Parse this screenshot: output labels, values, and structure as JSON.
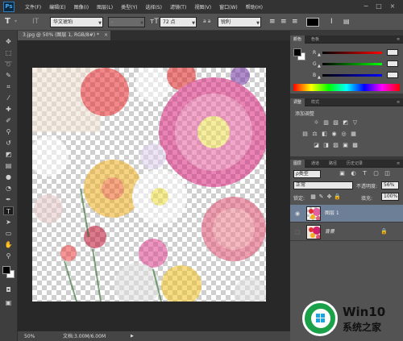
{
  "app": {
    "logo": "Ps"
  },
  "menu": [
    "文件(F)",
    "编辑(E)",
    "图像(I)",
    "图层(L)",
    "类型(Y)",
    "选择(S)",
    "滤镜(T)",
    "视图(V)",
    "窗口(W)",
    "帮助(H)"
  ],
  "window_controls": {
    "minimize": "−",
    "restore": "□",
    "close": "×"
  },
  "options": {
    "tool_icon": "type-tool-icon",
    "orientation_icon": "toggle-orientation-icon",
    "font_family": "华文琥珀",
    "font_style": "-",
    "font_size": "72 点",
    "aa_label": "a a",
    "aa_mode": "锐利",
    "color": "#000000"
  },
  "tools": [
    "move-tool-icon",
    "marquee-tool-icon",
    "lasso-tool-icon",
    "quick-select-icon",
    "crop-tool-icon",
    "eyedropper-icon",
    "healing-brush-icon",
    "brush-tool-icon",
    "clone-stamp-icon",
    "history-brush-icon",
    "eraser-tool-icon",
    "gradient-tool-icon",
    "blur-tool-icon",
    "dodge-tool-icon",
    "pen-tool-icon",
    "type-tool-icon",
    "path-select-icon",
    "shape-tool-icon",
    "hand-tool-icon",
    "zoom-tool-icon"
  ],
  "document": {
    "tab_title": "3.jpg @ 50% (图层 1, RGB/8#) *",
    "close": "×"
  },
  "status": {
    "zoom": "50%",
    "doc_info": "文档:3.00M/6.00M"
  },
  "color_panel": {
    "tabs": [
      "颜色",
      "色板"
    ],
    "channels": [
      {
        "label": "R",
        "color": "#ff0000"
      },
      {
        "label": "G",
        "color": "#00ff00"
      },
      {
        "label": "B",
        "color": "#0000ff"
      }
    ],
    "foreground": "#000000",
    "background": "#ffffff"
  },
  "adjust_panel": {
    "tabs": [
      "调整",
      "样式"
    ],
    "title": "添加调整"
  },
  "layers_panel": {
    "tabs": [
      "图层",
      "通道",
      "路径",
      "历史记录"
    ],
    "filter_kind": "ρ类型",
    "blend_mode": "正常",
    "opacity_label": "不透明度:",
    "opacity": "56%",
    "lock_label": "锁定:",
    "fill_label": "填充:",
    "fill": "100%",
    "layers": [
      {
        "name": "图层 1",
        "selected": true
      },
      {
        "name": "背景",
        "selected": false
      }
    ]
  },
  "watermark": {
    "title": "Win10",
    "subtitle": "系统之家"
  }
}
